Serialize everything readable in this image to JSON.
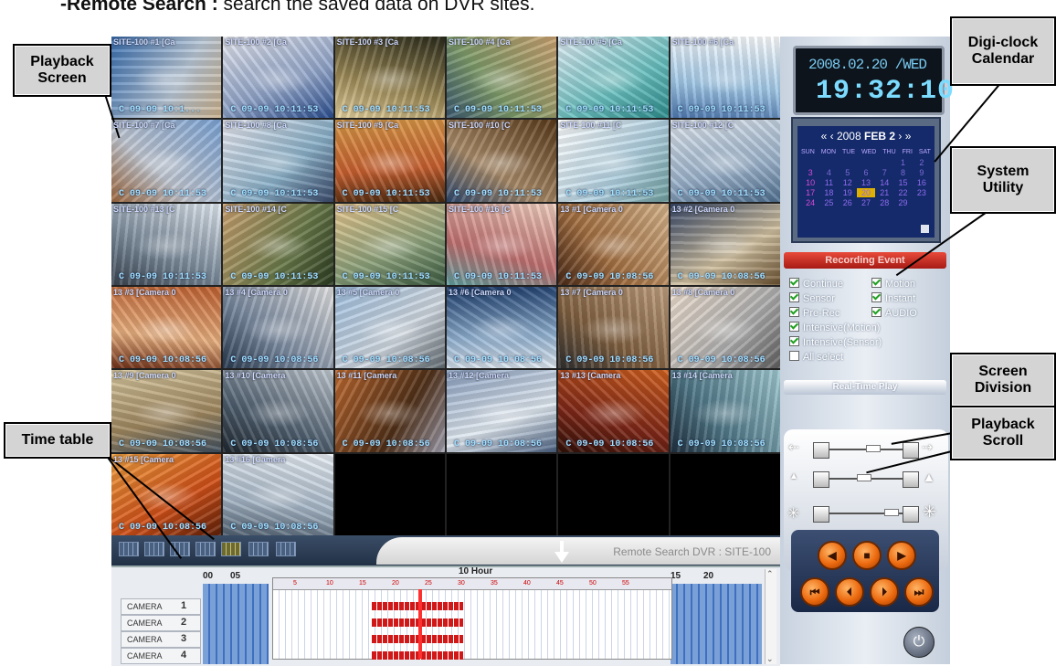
{
  "page_heading": {
    "term": "-Remote Search :",
    "description": " search the saved data on DVR sites."
  },
  "callouts": {
    "playback_screen": [
      "Playback",
      "Screen"
    ],
    "digi_clock": [
      "Digi-clock",
      "Calendar"
    ],
    "system_utility": [
      "System",
      "Utility"
    ],
    "screen_division": [
      "Screen",
      "Division"
    ],
    "playback_scroll": [
      "Playback",
      "Scroll"
    ],
    "time_table": [
      "Time table"
    ]
  },
  "cameras": [
    {
      "title": "SITE-100 #1 [Ca",
      "time": "C 09-09 10:1..."
    },
    {
      "title": "SITE-100 #2 [Ca",
      "time": "C 09-09 10:11:53"
    },
    {
      "title": "SITE-100 #3 [Ca",
      "time": "C 09-09 10:11:53"
    },
    {
      "title": "SITE-100 #4 [Ca",
      "time": "C 09-09 10:11:53"
    },
    {
      "title": "SITE-100 #5 [Ca",
      "time": "C 09-09 10:11:53"
    },
    {
      "title": "SITE-100 #6 [Ca",
      "time": "C 09-09 10:11:53"
    },
    {
      "title": "SITE-100 #7 [Ca",
      "time": "C 09-09 10:11:53"
    },
    {
      "title": "SITE-100 #8 [Ca",
      "time": "C 09-09 10:11:53"
    },
    {
      "title": "SITE-100 #9 [Ca",
      "time": "C 09-09 10:11:53"
    },
    {
      "title": "SITE-100 #10 [C",
      "time": "C 09-09 10:11:53"
    },
    {
      "title": "SITE-100 #11 [C",
      "time": "C 09-09 10:11:53"
    },
    {
      "title": "SITE-100 #12 [C",
      "time": "C 09-09 10:11:53"
    },
    {
      "title": "SITE-100 #13 [C",
      "time": "C 09-09 10:11:53"
    },
    {
      "title": "SITE-100 #14 [C",
      "time": "C 09-09 10:11:53"
    },
    {
      "title": "SITE-100 #15 [C",
      "time": "C 09-09 10:11:53"
    },
    {
      "title": "SITE-100 #16 [C",
      "time": "C 09-09 10:11:53"
    },
    {
      "title": "13 #1 [Camera 0",
      "time": "C 09-09 10:08:56"
    },
    {
      "title": "13 #2 [Camera 0",
      "time": "C 09-09 10:08:56"
    },
    {
      "title": "13 #3 [Camera 0",
      "time": "C 09-09 10:08:56"
    },
    {
      "title": "13 #4 [Camera 0",
      "time": "C 09-09 10:08:56"
    },
    {
      "title": "13 #5 [Camera 0",
      "time": "C 09-09 10:08:56"
    },
    {
      "title": "13 #6 [Camera 0",
      "time": "C 09-09 10:08:56"
    },
    {
      "title": "13 #7 [Camera 0",
      "time": "C 09-09 10:08:56"
    },
    {
      "title": "13 #8 [Camera 0",
      "time": "C 09-09 10:08:56"
    },
    {
      "title": "13 #9 [Camera 0",
      "time": "C 09-09 10:08:56"
    },
    {
      "title": "13 #10 [Camera",
      "time": "C 09-09 10:08:56"
    },
    {
      "title": "13 #11 [Camera",
      "time": "C 09-09 10:08:56"
    },
    {
      "title": "13 #12 [Camera",
      "time": "C 09-09 10:08:56"
    },
    {
      "title": "13 #13 [Camera",
      "time": "C 09-09 10:08:56"
    },
    {
      "title": "13 #14 [Camera",
      "time": "C 09-09 10:08:56"
    },
    {
      "title": "13 #15 [Camera",
      "time": "C 09-09 10:08:56"
    },
    {
      "title": "13 #16 [Camera",
      "time": "C 09-09 10:08:56"
    }
  ],
  "clock": {
    "date": "2008.02.20 /WED",
    "time": "19:32:10"
  },
  "calendar": {
    "nav_prev2": "«",
    "nav_prev1": "‹",
    "year": "2008",
    "month": "FEB",
    "month_num": "2",
    "nav_next1": "›",
    "nav_next2": "»",
    "weekdays": [
      "SUN",
      "MON",
      "TUE",
      "WED",
      "THU",
      "FRI",
      "SAT"
    ],
    "days": [
      "",
      "",
      "",
      "",
      "",
      "1",
      "2",
      "3",
      "4",
      "5",
      "6",
      "7",
      "8",
      "9",
      "10",
      "11",
      "12",
      "13",
      "14",
      "15",
      "16",
      "17",
      "18",
      "19",
      "20",
      "21",
      "22",
      "23",
      "24",
      "25",
      "26",
      "27",
      "28",
      "29",
      ""
    ],
    "today": "20"
  },
  "recording_event": {
    "label": "Recording Event",
    "options": [
      {
        "label": "Continue",
        "checked": true
      },
      {
        "label": "Motion",
        "checked": true
      },
      {
        "label": "Sensor",
        "checked": true
      },
      {
        "label": "Instant",
        "checked": true
      },
      {
        "label": "Pre-Rec",
        "checked": true
      },
      {
        "label": "AUDIO",
        "checked": true
      },
      {
        "label": "Intensive(Motion)",
        "checked": true
      },
      {
        "label": "Intensive(Sensor)",
        "checked": true
      },
      {
        "label": "All select",
        "checked": false
      }
    ]
  },
  "realtime_play_label": "Real-Time Play",
  "division_bar": {
    "remote_label": "Remote Search DVR : SITE-100"
  },
  "timetable": {
    "hour_label": "10 Hour",
    "left_ticks": [
      "00",
      "05"
    ],
    "right_ticks": [
      "15",
      "20"
    ],
    "zoom_ticks": [
      "5",
      "10",
      "15",
      "20",
      "25",
      "30",
      "35",
      "40",
      "45",
      "50",
      "55"
    ],
    "rows": [
      {
        "name": "CAMERA",
        "index": "1"
      },
      {
        "name": "CAMERA",
        "index": "2"
      },
      {
        "name": "CAMERA",
        "index": "3"
      },
      {
        "name": "CAMERA",
        "index": "4"
      }
    ]
  },
  "controls": {
    "play_prev": "◀",
    "stop": "■",
    "play": "▶",
    "first": "⏮",
    "step_back": "⏴",
    "step_fwd": "⏵",
    "last": "⏭",
    "power": "⏻"
  },
  "colors": {
    "accent_red": "#d01818",
    "timeline_blue": "#3f6fbf",
    "clock_text": "#7cdcff",
    "playback_orange": "#ec6a0f"
  }
}
